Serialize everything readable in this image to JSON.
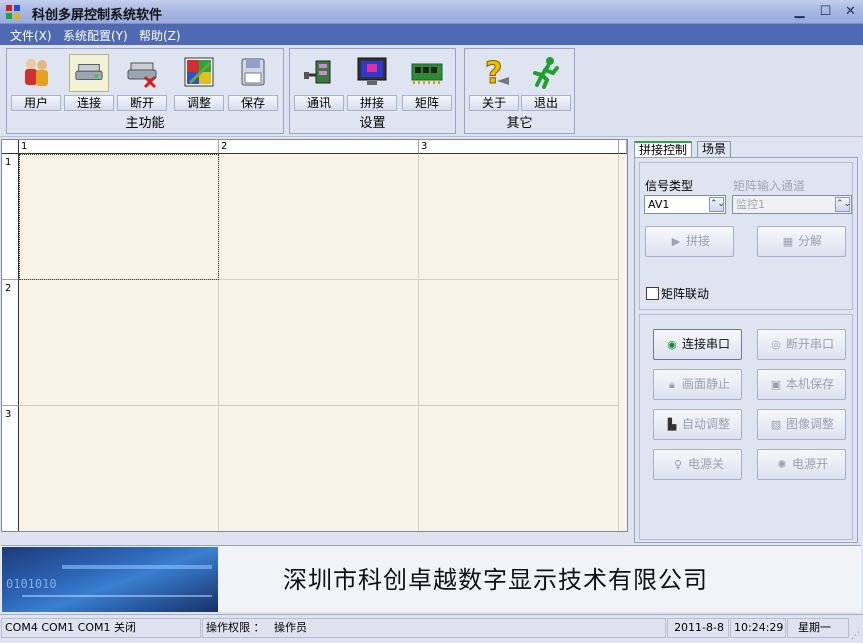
{
  "window": {
    "title": "科创多屏控制系统软件",
    "controls": {
      "min": "▁",
      "max": "☐",
      "close": "✕"
    }
  },
  "menu": [
    {
      "label": "文件(X)"
    },
    {
      "label": "系统配置(Y)"
    },
    {
      "label": "帮助(Z)"
    }
  ],
  "toolbar": {
    "groups": [
      {
        "label": "主功能",
        "buttons": [
          {
            "label": "用户",
            "icon": "users-icon"
          },
          {
            "label": "连接",
            "icon": "connect-icon",
            "pressed": true
          },
          {
            "label": "断开",
            "icon": "disconnect-icon"
          },
          {
            "label": "调整",
            "icon": "adjust-icon"
          },
          {
            "label": "保存",
            "icon": "save-icon"
          }
        ]
      },
      {
        "label": "设置",
        "buttons": [
          {
            "label": "通讯",
            "icon": "serial-port-icon"
          },
          {
            "label": "拼接",
            "icon": "monitor-icon"
          },
          {
            "label": "矩阵",
            "icon": "matrix-board-icon"
          }
        ]
      },
      {
        "label": "其它",
        "buttons": [
          {
            "label": "关于",
            "icon": "help-icon"
          },
          {
            "label": "退出",
            "icon": "exit-runner-icon"
          }
        ]
      }
    ]
  },
  "grid": {
    "columns": [
      "1",
      "2",
      "3"
    ],
    "rows": [
      "1",
      "2",
      "3"
    ],
    "selected_cell": "1-1"
  },
  "right_panel": {
    "tabs": [
      {
        "label": "拼接控制",
        "active": true
      },
      {
        "label": "场景",
        "active": false
      }
    ],
    "signal_type_label": "信号类型",
    "signal_type_value": "AV1",
    "matrix_input_label": "矩阵输入通道",
    "matrix_input_value": "监控1",
    "splice_button": "拼接",
    "split_button": "分解",
    "matrix_link_label": "矩阵联动",
    "matrix_link_checked": false,
    "buttons": [
      {
        "label": "连接串口",
        "enabled": true,
        "icon": "serial-connect-icon"
      },
      {
        "label": "断开串口",
        "enabled": false,
        "icon": "serial-disconnect-icon"
      },
      {
        "label": "画面静止",
        "enabled": false,
        "icon": "lock-icon"
      },
      {
        "label": "本机保存",
        "enabled": false,
        "icon": "save-local-icon"
      },
      {
        "label": "自动调整",
        "enabled": false,
        "icon": "auto-adjust-icon"
      },
      {
        "label": "图像调整",
        "enabled": false,
        "icon": "image-adjust-icon"
      },
      {
        "label": "电源关",
        "enabled": false,
        "icon": "bulb-off-icon"
      },
      {
        "label": "电源开",
        "enabled": false,
        "icon": "bulb-on-icon"
      }
    ]
  },
  "banner": {
    "binary_text": "0101010",
    "company": "深圳市科创卓越数字显示技术有限公司"
  },
  "status": {
    "ports": "COM4 COM1 COM1 关闭",
    "permission_label": "操作权限 ：",
    "permission_value": "操作员",
    "date": "2011-8-8",
    "time": "10:24:29",
    "weekday": "星期一"
  },
  "colors": {
    "menu_bg": "#5069b3",
    "grid_bg": "#f9f4e6",
    "active_tab_accent": "#2aa34b"
  }
}
